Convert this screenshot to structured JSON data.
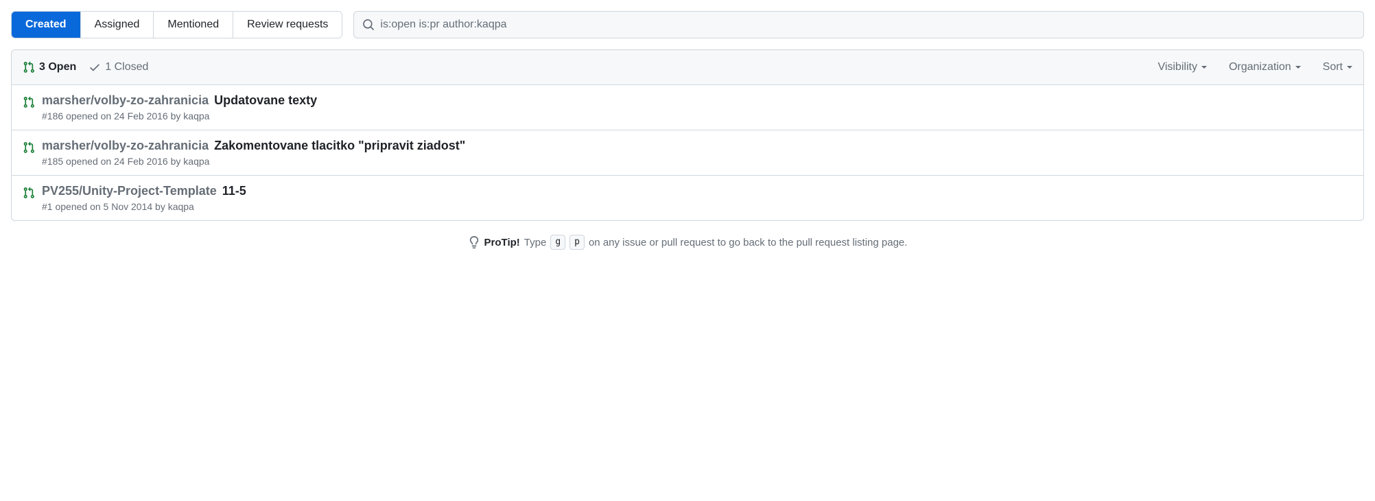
{
  "tabs": {
    "created": "Created",
    "assigned": "Assigned",
    "mentioned": "Mentioned",
    "review_requests": "Review requests"
  },
  "search": {
    "value": "is:open is:pr author:kaqpa"
  },
  "header": {
    "open_count": "3 Open",
    "closed_count": "1 Closed",
    "filters": {
      "visibility": "Visibility",
      "organization": "Organization",
      "sort": "Sort"
    }
  },
  "items": [
    {
      "repo": "marsher/volby-zo-zahranicia",
      "title": "Updatovane texty",
      "meta_prefix": "#186 opened on 24 Feb 2016 by ",
      "author": "kaqpa"
    },
    {
      "repo": "marsher/volby-zo-zahranicia",
      "title": "Zakomentovane tlacitko \"pripravit ziadost\"",
      "meta_prefix": "#185 opened on 24 Feb 2016 by ",
      "author": "kaqpa"
    },
    {
      "repo": "PV255/Unity-Project-Template",
      "title": "11-5",
      "meta_prefix": "#1 opened on 5 Nov 2014 by ",
      "author": "kaqpa"
    }
  ],
  "protip": {
    "label": "ProTip!",
    "before": "Type",
    "key1": "g",
    "key2": "p",
    "after": "on any issue or pull request to go back to the pull request listing page."
  }
}
